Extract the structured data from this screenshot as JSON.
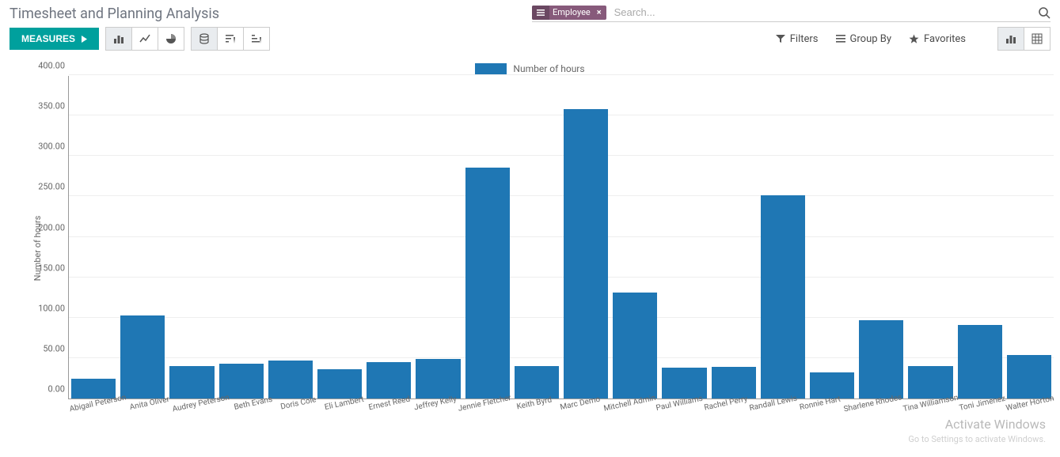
{
  "header": {
    "title": "Timesheet and Planning Analysis",
    "search_facet_label": "Employee",
    "search_placeholder": "Search..."
  },
  "toolbar": {
    "measures_label": "MEASURES",
    "filters_label": "Filters",
    "groupby_label": "Group By",
    "favorites_label": "Favorites"
  },
  "legend_label": "Number of hours",
  "watermark": {
    "line1": "Activate Windows",
    "line2": "Go to Settings to activate Windows."
  },
  "chart_data": {
    "type": "bar",
    "ylabel": "Number of hours",
    "xlabel": "",
    "ylim": [
      0,
      400
    ],
    "yticks": [
      "0.00",
      "50.00",
      "100.00",
      "150.00",
      "200.00",
      "250.00",
      "300.00",
      "350.00",
      "400.00"
    ],
    "categories": [
      "Abigail Peterson",
      "Anita Oliver",
      "Audrey Peterson",
      "Beth Evans",
      "Doris Cole",
      "Eli Lambert",
      "Ernest Reed",
      "Jeffrey Kelly",
      "Jennie Fletcher",
      "Keith Byrd",
      "Marc Demo",
      "Mitchell Admin",
      "Paul Williams",
      "Rachel Perry",
      "Randall Lewis",
      "Ronnie Hart",
      "Sharlene Rhodes",
      "Tina Williamson",
      "Toni Jimenez",
      "Walter Horton"
    ],
    "values": [
      25,
      103,
      40,
      43,
      47,
      36,
      45,
      49,
      286,
      40,
      359,
      131,
      38,
      39,
      252,
      32,
      97,
      40,
      91,
      54
    ],
    "series_color": "#1f77b4",
    "legend": "Number of hours"
  }
}
